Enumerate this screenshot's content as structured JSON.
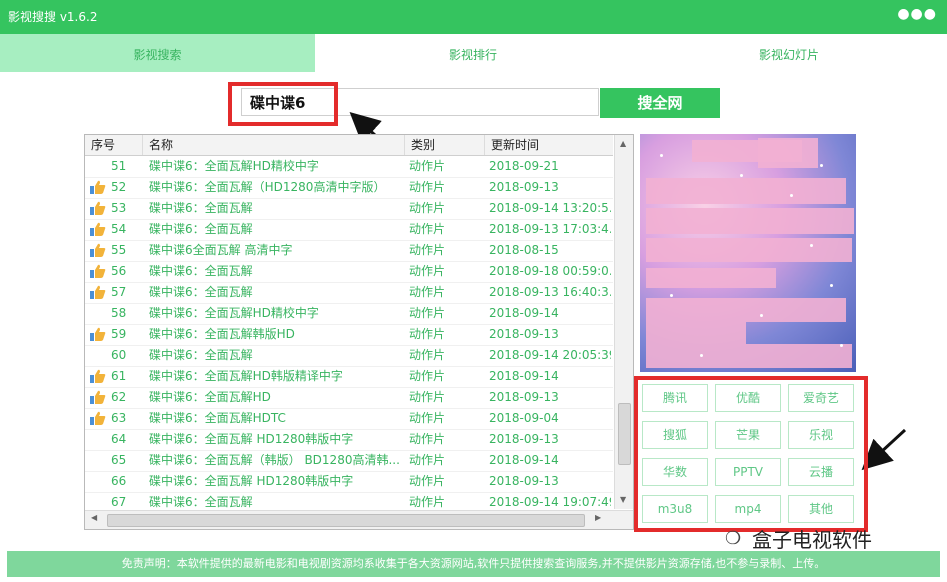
{
  "app": {
    "title": "影视搜搜 v1.6.2",
    "more_icon": "more-dots-icon"
  },
  "tabs": [
    {
      "label": "影视搜索",
      "active": true
    },
    {
      "label": "影视排行",
      "active": false
    },
    {
      "label": "影视幻灯片",
      "active": false
    }
  ],
  "search": {
    "value": "碟中谍6",
    "button_label": "搜全网"
  },
  "table": {
    "headers": [
      "序号",
      "名称",
      "类别",
      "更新时间"
    ],
    "rows": [
      {
        "no": "51",
        "name": "碟中谍6：全面瓦解HD精校中字",
        "cat": "动作片",
        "time": "2018-09-21",
        "thumb": false
      },
      {
        "no": "52",
        "name": "碟中谍6：全面瓦解（HD1280高清中字版）",
        "cat": "动作片",
        "time": "2018-09-13",
        "thumb": true
      },
      {
        "no": "53",
        "name": "碟中谍6：全面瓦解",
        "cat": "动作片",
        "time": "2018-09-14 13:20:5...",
        "thumb": true
      },
      {
        "no": "54",
        "name": "碟中谍6：全面瓦解",
        "cat": "动作片",
        "time": "2018-09-13 17:03:4...",
        "thumb": true
      },
      {
        "no": "55",
        "name": "碟中谍6全面瓦解 高清中字",
        "cat": "动作片",
        "time": "2018-08-15",
        "thumb": true
      },
      {
        "no": "56",
        "name": "碟中谍6：全面瓦解",
        "cat": "动作片",
        "time": "2018-09-18 00:59:0...",
        "thumb": true
      },
      {
        "no": "57",
        "name": "碟中谍6：全面瓦解",
        "cat": "动作片",
        "time": "2018-09-13 16:40:3...",
        "thumb": true
      },
      {
        "no": "58",
        "name": "碟中谍6：全面瓦解HD精校中字",
        "cat": "动作片",
        "time": "2018-09-14",
        "thumb": false
      },
      {
        "no": "59",
        "name": "碟中谍6：全面瓦解韩版HD",
        "cat": "动作片",
        "time": "2018-09-13",
        "thumb": true
      },
      {
        "no": "60",
        "name": "碟中谍6：全面瓦解",
        "cat": "动作片",
        "time": "2018-09-14 20:05:39",
        "thumb": false
      },
      {
        "no": "61",
        "name": "碟中谍6：全面瓦解HD韩版精译中字",
        "cat": "动作片",
        "time": "2018-09-14",
        "thumb": true
      },
      {
        "no": "62",
        "name": "碟中谍6：全面瓦解HD",
        "cat": "动作片",
        "time": "2018-09-13",
        "thumb": true
      },
      {
        "no": "63",
        "name": "碟中谍6：全面瓦解HDTC",
        "cat": "动作片",
        "time": "2018-09-04",
        "thumb": true
      },
      {
        "no": "64",
        "name": "碟中谍6：全面瓦解 HD1280韩版中字",
        "cat": "动作片",
        "time": "2018-09-13",
        "thumb": false
      },
      {
        "no": "65",
        "name": "碟中谍6：全面瓦解（韩版） BD1280高清韩...",
        "cat": "动作片",
        "time": "2018-09-14",
        "thumb": false
      },
      {
        "no": "66",
        "name": "碟中谍6：全面瓦解 HD1280韩版中字",
        "cat": "动作片",
        "time": "2018-09-13",
        "thumb": false
      },
      {
        "no": "67",
        "name": "碟中谍6：全面瓦解",
        "cat": "动作片",
        "time": "2018-09-14 19:07:49",
        "thumb": false
      }
    ]
  },
  "sources": [
    "腾讯",
    "优酷",
    "爱奇艺",
    "搜狐",
    "芒果",
    "乐视",
    "华数",
    "PPTV",
    "云播",
    "m3u8",
    "mp4",
    "其他"
  ],
  "footer": {
    "text": "免责声明：本软件提供的最新电影和电视剧资源均系收集于各大资源网站,软件只提供搜索查询服务,并不提供影片资源存储,也不参与录制、上传。"
  },
  "watermark": {
    "text": "盒子电视软件"
  },
  "colors": {
    "accent": "#35c45f",
    "tab_active": "#a7eec1",
    "row_text": "#38b460",
    "annotation": "#e32b2b"
  }
}
